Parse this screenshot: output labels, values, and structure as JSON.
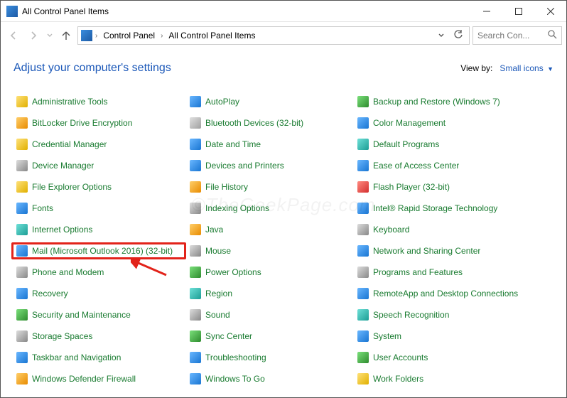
{
  "window": {
    "title": "All Control Panel Items"
  },
  "breadcrumb": {
    "root": "Control Panel",
    "child": "All Control Panel Items"
  },
  "search": {
    "placeholder": "Search Con..."
  },
  "page": {
    "heading": "Adjust your computer's settings",
    "viewby_label": "View by:",
    "viewby_value": "Small icons"
  },
  "watermark": "©TheGeekPage.com",
  "items": [
    {
      "name": "Administrative Tools",
      "icon": "i-yellow"
    },
    {
      "name": "AutoPlay",
      "icon": "i-blue"
    },
    {
      "name": "Backup and Restore (Windows 7)",
      "icon": "i-green"
    },
    {
      "name": "BitLocker Drive Encryption",
      "icon": "i-orange"
    },
    {
      "name": "Bluetooth Devices (32-bit)",
      "icon": "i-generic"
    },
    {
      "name": "Color Management",
      "icon": "i-blue"
    },
    {
      "name": "Credential Manager",
      "icon": "i-yellow"
    },
    {
      "name": "Date and Time",
      "icon": "i-blue"
    },
    {
      "name": "Default Programs",
      "icon": "i-teal"
    },
    {
      "name": "Device Manager",
      "icon": "i-gray"
    },
    {
      "name": "Devices and Printers",
      "icon": "i-blue"
    },
    {
      "name": "Ease of Access Center",
      "icon": "i-blue"
    },
    {
      "name": "File Explorer Options",
      "icon": "i-yellow"
    },
    {
      "name": "File History",
      "icon": "i-orange"
    },
    {
      "name": "Flash Player (32-bit)",
      "icon": "i-red"
    },
    {
      "name": "Fonts",
      "icon": "i-blue"
    },
    {
      "name": "Indexing Options",
      "icon": "i-gray"
    },
    {
      "name": "Intel® Rapid Storage Technology",
      "icon": "i-blue"
    },
    {
      "name": "Internet Options",
      "icon": "i-teal"
    },
    {
      "name": "Java",
      "icon": "i-orange"
    },
    {
      "name": "Keyboard",
      "icon": "i-gray"
    },
    {
      "name": "Mail (Microsoft Outlook 2016) (32-bit)",
      "icon": "i-blue",
      "highlight": true
    },
    {
      "name": "Mouse",
      "icon": "i-gray"
    },
    {
      "name": "Network and Sharing Center",
      "icon": "i-blue"
    },
    {
      "name": "Phone and Modem",
      "icon": "i-gray"
    },
    {
      "name": "Power Options",
      "icon": "i-green"
    },
    {
      "name": "Programs and Features",
      "icon": "i-gray"
    },
    {
      "name": "Recovery",
      "icon": "i-blue"
    },
    {
      "name": "Region",
      "icon": "i-teal"
    },
    {
      "name": "RemoteApp and Desktop Connections",
      "icon": "i-blue"
    },
    {
      "name": "Security and Maintenance",
      "icon": "i-green"
    },
    {
      "name": "Sound",
      "icon": "i-gray"
    },
    {
      "name": "Speech Recognition",
      "icon": "i-teal"
    },
    {
      "name": "Storage Spaces",
      "icon": "i-gray"
    },
    {
      "name": "Sync Center",
      "icon": "i-green"
    },
    {
      "name": "System",
      "icon": "i-blue"
    },
    {
      "name": "Taskbar and Navigation",
      "icon": "i-blue"
    },
    {
      "name": "Troubleshooting",
      "icon": "i-blue"
    },
    {
      "name": "User Accounts",
      "icon": "i-green"
    },
    {
      "name": "Windows Defender Firewall",
      "icon": "i-orange"
    },
    {
      "name": "Windows To Go",
      "icon": "i-blue"
    },
    {
      "name": "Work Folders",
      "icon": "i-yellow"
    }
  ]
}
